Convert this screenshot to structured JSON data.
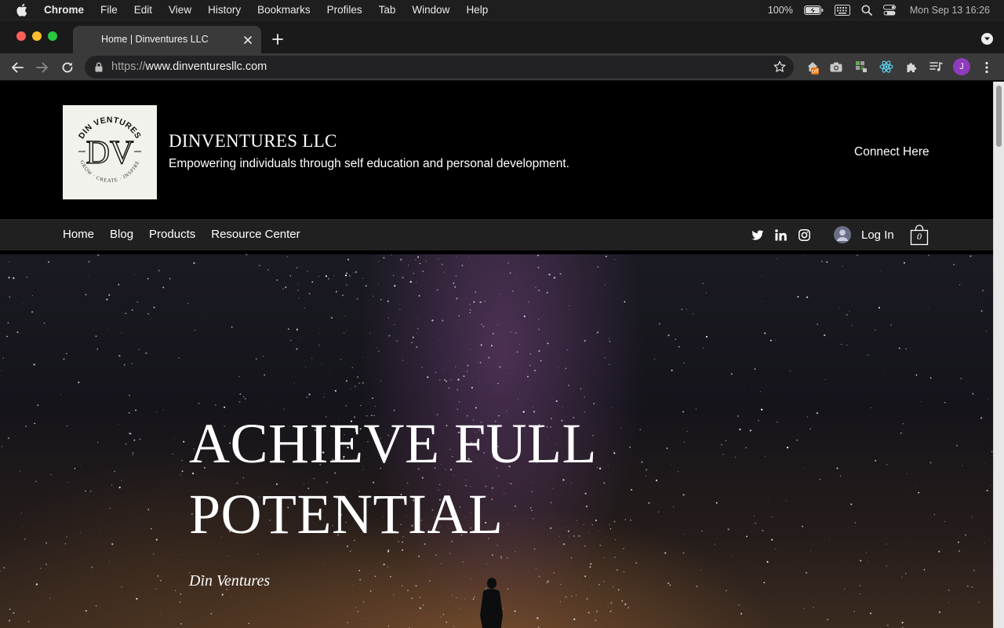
{
  "menubar": {
    "app_name": "Chrome",
    "items": [
      "File",
      "Edit",
      "View",
      "History",
      "Bookmarks",
      "Profiles",
      "Tab",
      "Window",
      "Help"
    ],
    "battery": "100%",
    "clock": "Mon Sep 13  16:26"
  },
  "browser": {
    "tab_title": "Home | Dinventures LLC",
    "url_scheme": "https://",
    "url_host": "www.dinventuresllc.com",
    "extension_badge": "off",
    "profile_initial": "J"
  },
  "site": {
    "logo": {
      "ring_text": "DIN VENTURES",
      "monogram": "DV",
      "bottom_text": "GROW · CREATE · INSPIRE"
    },
    "title": "DINVENTURES LLC",
    "tagline": "Empowering individuals through self education and personal development.",
    "connect_label": "Connect Here",
    "nav": [
      "Home",
      "Blog",
      "Products",
      "Resource Center"
    ],
    "social": [
      "twitter-icon",
      "linkedin-icon",
      "instagram-icon"
    ],
    "login_label": "Log In",
    "cart_count": "0"
  },
  "hero": {
    "title_line1": "ACHIEVE FULL",
    "title_line2": "POTENTIAL",
    "subtitle": "Din Ventures"
  }
}
